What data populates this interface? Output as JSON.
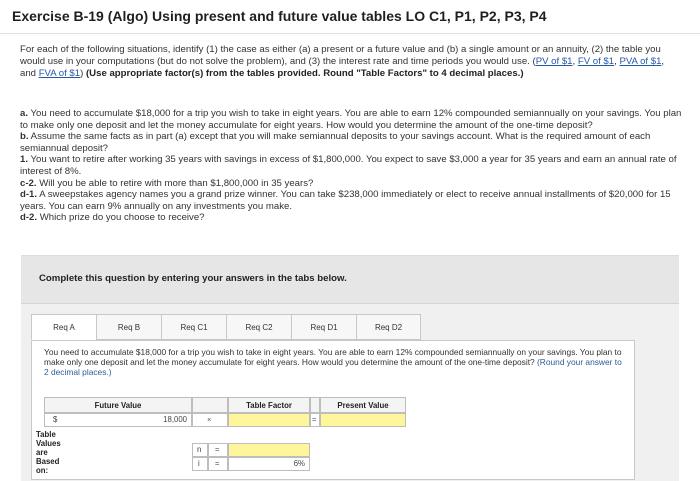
{
  "header": {
    "title": "Exercise B-19 (Algo) Using present and future value tables LO C1, P1, P2, P3, P4"
  },
  "instructions": {
    "text_before": "For each of the following situations, identify (1) the case as either (a) a present or a future value and (b) a single amount or an annuity, (2) the table you would use in your computations (but do not solve the problem), and (3) the interest rate and time periods you would use. (",
    "links": [
      "PV of $1",
      "FV of $1",
      "PVA of $1",
      "FVA of $1"
    ],
    "text_after_links": ")",
    "bold_text": "(Use appropriate factor(s) from the tables provided. Round \"Table Factors\" to 4 decimal places.)"
  },
  "scenarios": [
    {
      "label": "a.",
      "text": "You need to accumulate $18,000 for a trip you wish to take in eight years. You are able to earn 12% compounded semiannually on your savings. You plan to make only one deposit and let the money accumulate for eight years. How would you determine the amount of the one-time deposit?"
    },
    {
      "label": "b.",
      "text": "Assume the same facts as in part (a) except that you will make semiannual deposits to your savings account. What is the required amount of each semiannual deposit?"
    },
    {
      "label": "1.",
      "text": "You want to retire after working 35 years with savings in excess of $1,800,000. You expect to save $3,000 a year for 35 years and earn an annual rate of interest of 8%."
    },
    {
      "label": "c-2.",
      "text": "Will you be able to retire with more than $1,800,000 in 35 years?"
    },
    {
      "label": "d-1.",
      "text": "A sweepstakes agency names you a grand prize winner. You can take $238,000 immediately or elect to receive annual installments of $20,000 for 15 years. You can earn 9% annually on any investments you make."
    },
    {
      "label": "d-2.",
      "text": "Which prize do you choose to receive?"
    }
  ],
  "panel": {
    "heading": "Complete this question by entering your answers in the tabs below."
  },
  "tabs": [
    {
      "label": "Req A",
      "active": true
    },
    {
      "label": "Req B",
      "active": false
    },
    {
      "label": "Req C1",
      "active": false
    },
    {
      "label": "Req C2",
      "active": false
    },
    {
      "label": "Req D1",
      "active": false
    },
    {
      "label": "Req D2",
      "active": false
    }
  ],
  "question": {
    "text": "You need to accumulate $18,000 for a trip you wish to take in eight years. You are able to earn 12% compounded semiannually on your savings. You plan to make only one deposit and let the money accumulate for eight years. How would you determine the amount of the one-time deposit?",
    "hint": "(Round your answer to 2 decimal places.)"
  },
  "table": {
    "col_future_value": "Future Value",
    "col_table_factor": "Table Factor",
    "col_present_value": "Present Value",
    "currency": "$",
    "future_value": "18,000",
    "op_multiply": "×",
    "op_equals": "=",
    "based_on_label": "Table Values are Based on:",
    "n_label": "n",
    "i_label": "i",
    "i_value": "6%",
    "n_value": "",
    "table_factor_value": "",
    "present_value_value": ""
  }
}
